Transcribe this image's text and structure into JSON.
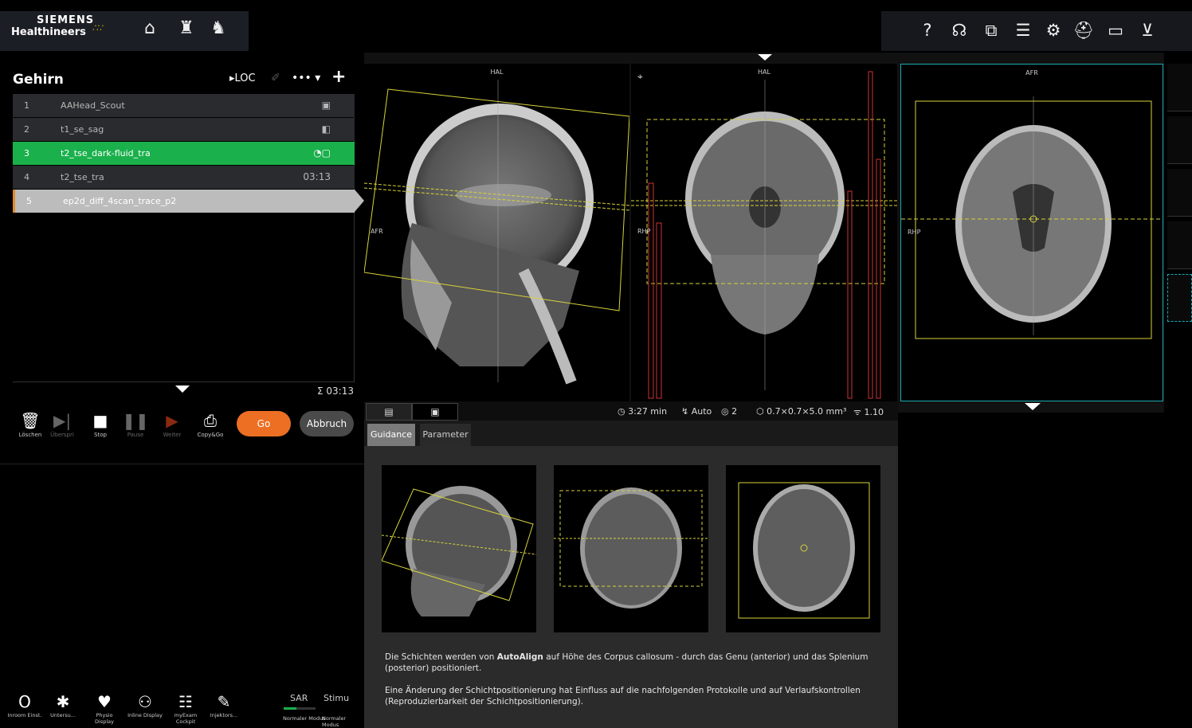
{
  "brand": {
    "line1": "SIEMENS",
    "line2": "Healthineers"
  },
  "exam": {
    "title": "Gehirn",
    "loc_label": "LOC"
  },
  "queue": [
    {
      "num": "1",
      "name": "AAHead_Scout",
      "right": "▣"
    },
    {
      "num": "2",
      "name": "t1_se_sag",
      "right": "◧"
    },
    {
      "num": "3",
      "name": "t2_tse_dark-fluid_tra",
      "right": "◔▢"
    },
    {
      "num": "4",
      "name": "t2_tse_tra",
      "right": "03:13"
    },
    {
      "num": "5",
      "name": "ep2d_diff_4scan_trace_p2",
      "right": ""
    }
  ],
  "total_time": "Σ 03:13",
  "controls": {
    "delete": "Löschen",
    "skip": "Überspri",
    "stop": "Stop",
    "pause": "Pause",
    "next": "Weiter",
    "copygo": "Copy&Go",
    "go": "Go",
    "abort": "Abbruch"
  },
  "bottom_tools": [
    {
      "icon": "Ο",
      "label": "Inroom Einst."
    },
    {
      "icon": "✱",
      "label": "Untersu..."
    },
    {
      "icon": "♥",
      "label": "Physio Display"
    },
    {
      "icon": "⚇",
      "label": "Inline Display"
    },
    {
      "icon": "☷",
      "label": "myExam Cockpit"
    },
    {
      "icon": "✎",
      "label": "Injektors..."
    }
  ],
  "sar": {
    "label": "SAR",
    "mode": "Normaler Modus",
    "level": 0.4
  },
  "stim": {
    "label": "Stimu",
    "mode": "Normaler Modus"
  },
  "viewports": [
    {
      "top": "HAL",
      "left": "AFR"
    },
    {
      "top": "HAL",
      "left": "RHP"
    },
    {
      "top": "AFR",
      "left": "RHP"
    }
  ],
  "status": {
    "time": "3:27 min",
    "auto": "Auto",
    "count": "2",
    "voxel": "0.7×0.7×5.0 mm³",
    "factor": "1.10"
  },
  "guide": {
    "tab_guidance": "Guidance",
    "tab_parameter": "Parameter",
    "text1_a": "Die Schichten werden von ",
    "text1_b": "AutoAlign",
    "text1_c": " auf Höhe des Corpus callosum - durch das Genu (anterior) und das Splenium (posterior) positioniert.",
    "text2": "Eine Änderung der Schichtpositionierung hat Einfluss auf die nachfolgenden Protokolle und auf Verlaufskontrollen (Reproduzierbarkeit der Schichtpositionierung)."
  },
  "colors": {
    "active": "#1ab04c",
    "go": "#ec6f23",
    "focus": "#1aa9b2",
    "plan": "#d8d23a"
  }
}
